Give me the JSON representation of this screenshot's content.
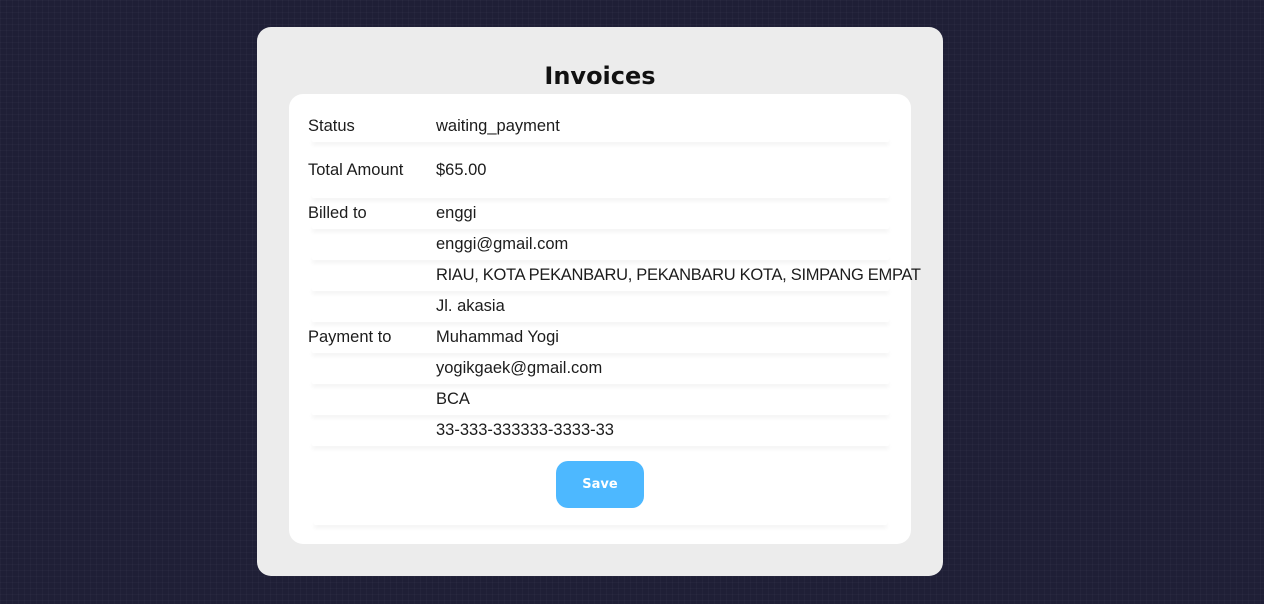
{
  "page": {
    "title": "Invoices"
  },
  "invoice": {
    "status": {
      "label": "Status",
      "value": "waiting_payment"
    },
    "total": {
      "label": "Total Amount",
      "value": "$65.00"
    },
    "billed_to": {
      "label": "Billed to",
      "name": "enggi",
      "email": "enggi@gmail.com",
      "region": "RIAU, KOTA PEKANBARU, PEKANBARU KOTA, SIMPANG EMPAT",
      "street": "Jl. akasia"
    },
    "payment_to": {
      "label": "Payment to",
      "name": "Muhammad Yogi",
      "email": "yogikgaek@gmail.com",
      "bank": "BCA",
      "account": "33-333-333333-3333-33"
    }
  },
  "actions": {
    "save_label": "Save"
  },
  "colors": {
    "background": "#1f1f36",
    "card": "#ececec",
    "panel": "#ffffff",
    "accent": "#4db8ff"
  }
}
